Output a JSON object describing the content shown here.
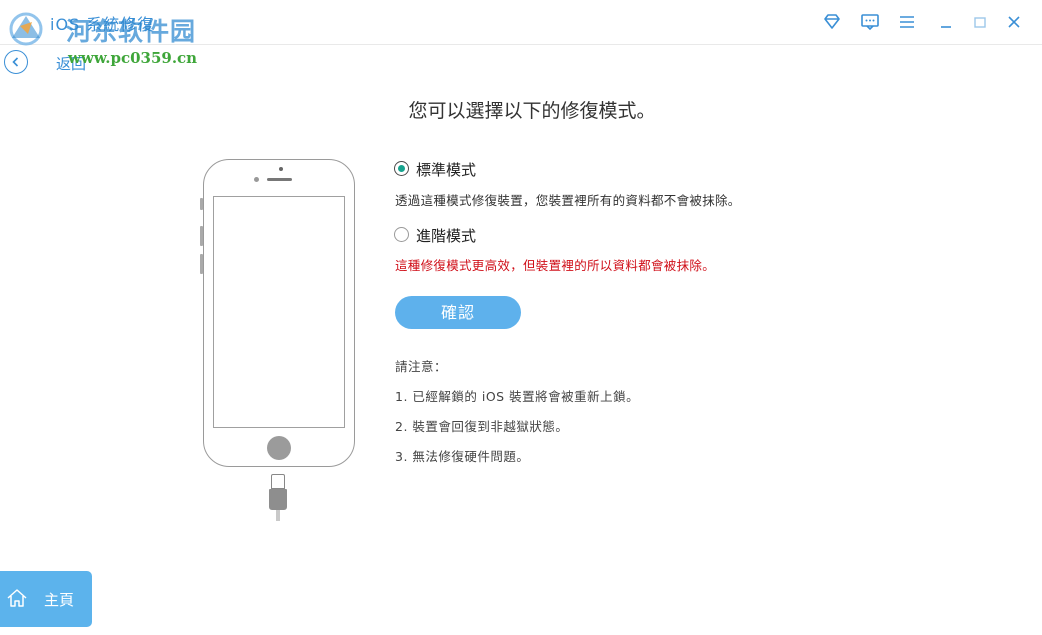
{
  "window": {
    "title": "iOS 系統修復",
    "watermark_text": "河东软件园",
    "watermark_url": "www.pc0359.cn"
  },
  "toolbar": {
    "icons": [
      "diamond-icon",
      "feedback-icon",
      "menu-icon",
      "minimize-icon",
      "maximize-icon",
      "close-icon"
    ]
  },
  "nav": {
    "back_label": "返回"
  },
  "main": {
    "headline": "您可以選擇以下的修復模式。",
    "options": [
      {
        "label": "標準模式",
        "selected": true,
        "description": "透過這種模式修復裝置，您裝置裡所有的資料都不會被抹除。"
      },
      {
        "label": "進階模式",
        "selected": false,
        "description": "這種修復模式更高效，但裝置裡的所以資料都會被抹除。"
      }
    ],
    "confirm_label": "確認",
    "notes_title": "請注意：",
    "notes": [
      "1. 已經解鎖的 iOS 裝置將會被重新上鎖。",
      "2. 裝置會回復到非越獄狀態。",
      "3. 無法修復硬件問題。"
    ]
  },
  "sidebar": {
    "home_label": "主頁"
  },
  "colors": {
    "accent": "#5cb3ec",
    "title_blue": "#3a8fd6",
    "radio_selected": "#17a38e",
    "warning_red": "#d0101a"
  }
}
